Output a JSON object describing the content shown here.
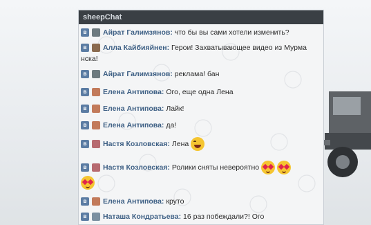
{
  "window": {
    "title": "sheepChat"
  },
  "messages": [
    {
      "author": "Айрат Галимзянов",
      "text": "что бы вы сами хотели изменить?",
      "avatar_color": "#6d7a7f"
    },
    {
      "author": "Алла Кайбияйнен",
      "text": "Герои! Захватывающее видео из Мурма",
      "text_cont": "нска!",
      "avatar_color": "#8a6a4e"
    },
    {
      "author": "Айрат Галимзянов",
      "text": "реклама! бан",
      "avatar_color": "#6d7a7f"
    },
    {
      "author": "Елена Антипова",
      "text": "Ого, еще одна Лена",
      "avatar_color": "#c27a5a"
    },
    {
      "author": "Елена Антипова",
      "text": "Лайк!",
      "avatar_color": "#c27a5a"
    },
    {
      "author": "Елена Антипова",
      "text": "да!",
      "avatar_color": "#c27a5a"
    },
    {
      "author": "Настя Козловская",
      "text": "Лена",
      "emoji": "laughing-emoji",
      "avatar_color": "#b76a70"
    },
    {
      "author": "Настя Козловская",
      "text": "Ролики сняты невероятно",
      "emoji": "heart-eyes-emoji",
      "avatar_color": "#b76a70"
    },
    {
      "author": "Елена Антипова",
      "text": "круто",
      "avatar_color": "#c27a5a"
    },
    {
      "author": "Наташа Кондратьева",
      "text": "16 раз побеждали?! Ого",
      "avatar_color": "#7a8fa0"
    }
  ],
  "colors": {
    "title_bar": "#3a3f44",
    "author_name": "#3d5f84",
    "vk_badge": "#5b7ca3"
  },
  "icons": {
    "source_badge": "vk-icon",
    "emoji_laugh": "laughing-emoji",
    "emoji_love": "heart-eyes-emoji"
  }
}
